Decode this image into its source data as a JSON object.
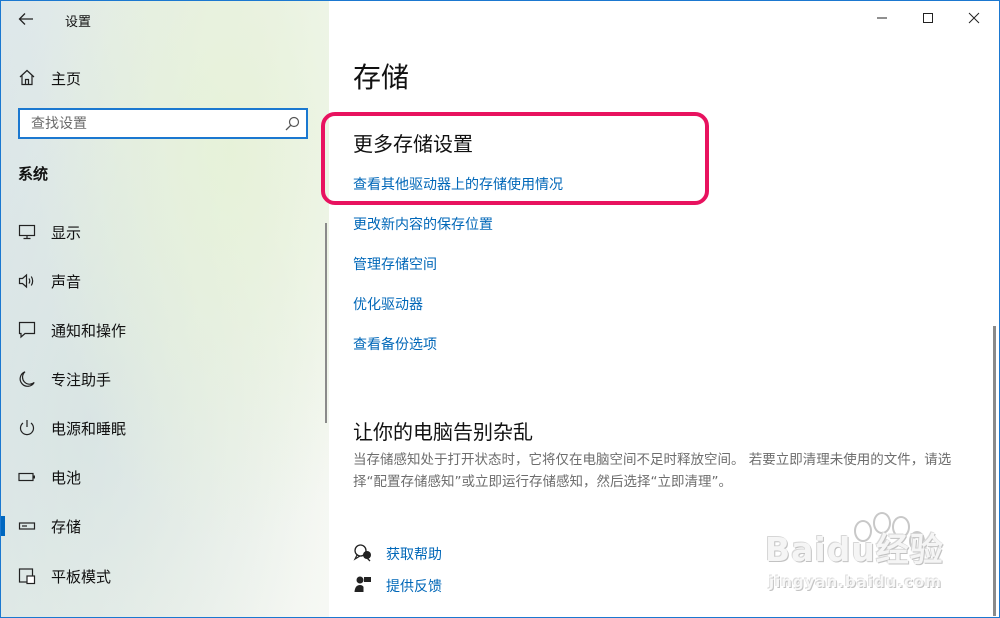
{
  "window": {
    "title": "设置"
  },
  "sidebar": {
    "home_label": "主页",
    "search": {
      "placeholder": "查找设置",
      "value": ""
    },
    "section_title": "系统",
    "items": [
      {
        "label": "显示",
        "icon": "monitor-icon",
        "selected": false
      },
      {
        "label": "声音",
        "icon": "speaker-icon",
        "selected": false
      },
      {
        "label": "通知和操作",
        "icon": "notification-icon",
        "selected": false
      },
      {
        "label": "专注助手",
        "icon": "moon-icon",
        "selected": false
      },
      {
        "label": "电源和睡眠",
        "icon": "power-icon",
        "selected": false
      },
      {
        "label": "电池",
        "icon": "battery-icon",
        "selected": false
      },
      {
        "label": "存储",
        "icon": "storage-icon",
        "selected": true
      },
      {
        "label": "平板模式",
        "icon": "tablet-mode-icon",
        "selected": false
      }
    ]
  },
  "main": {
    "title": "存储",
    "more_storage": {
      "heading": "更多存储设置",
      "links": [
        "查看其他驱动器上的存储使用情况",
        "更改新内容的保存位置",
        "管理存储空间",
        "优化驱动器",
        "查看备份选项"
      ]
    },
    "declutter": {
      "heading": "让你的电脑告别杂乱",
      "description": "当存储感知处于打开状态时，它将仅在电脑空间不足时释放空间。 若要立即清理未使用的文件，请选择“配置存储感知”或立即运行存储感知，然后选择“立即清理”。"
    },
    "help": {
      "get_help": "获取帮助",
      "feedback": "提供反馈"
    }
  },
  "watermark": {
    "text": "Baidu经验",
    "sub": "jingyan.baidu.com"
  },
  "colors": {
    "accent": "#0067b8",
    "highlight": "#e8125f",
    "selection": "#0067c0"
  }
}
